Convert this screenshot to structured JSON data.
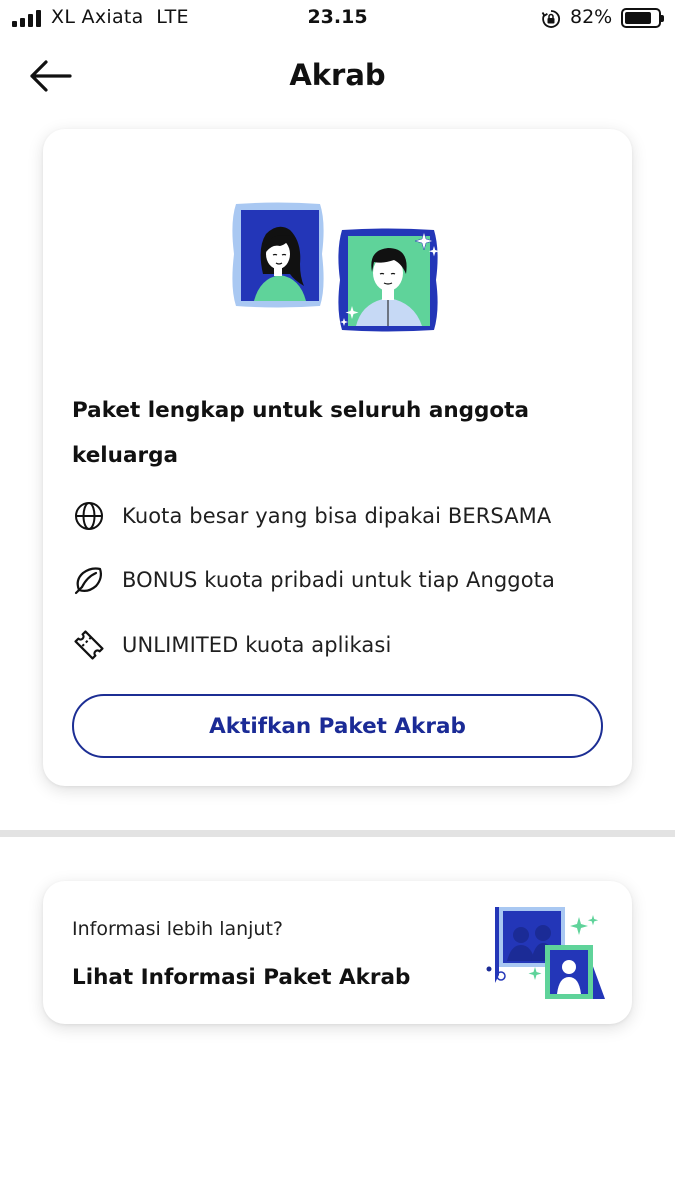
{
  "status_bar": {
    "carrier": "XL Axiata",
    "network": "LTE",
    "time": "23.15",
    "battery_percent": "82%",
    "battery_level": 0.82,
    "signal_bars": 4
  },
  "header": {
    "title": "Akrab"
  },
  "main_card": {
    "heading": "Paket lengkap untuk seluruh anggota keluarga",
    "features": [
      {
        "icon": "globe-icon",
        "text": "Kuota besar yang bisa dipakai BERSAMA"
      },
      {
        "icon": "bonus-leaf-icon",
        "text": "BONUS kuota pribadi untuk tiap Anggota"
      },
      {
        "icon": "ticket-icon",
        "text": "UNLIMITED kuota aplikasi"
      }
    ],
    "cta_label": "Aktifkan Paket Akrab"
  },
  "info_card": {
    "subtitle": "Informasi lebih lanjut?",
    "title": "Lihat Informasi Paket Akrab"
  },
  "colors": {
    "primary_blue": "#1b2b96",
    "frame_blue": "#2336b8",
    "light_blue": "#a9c8f2",
    "mint": "#5fd39a",
    "divider": "#e3e3e3"
  }
}
